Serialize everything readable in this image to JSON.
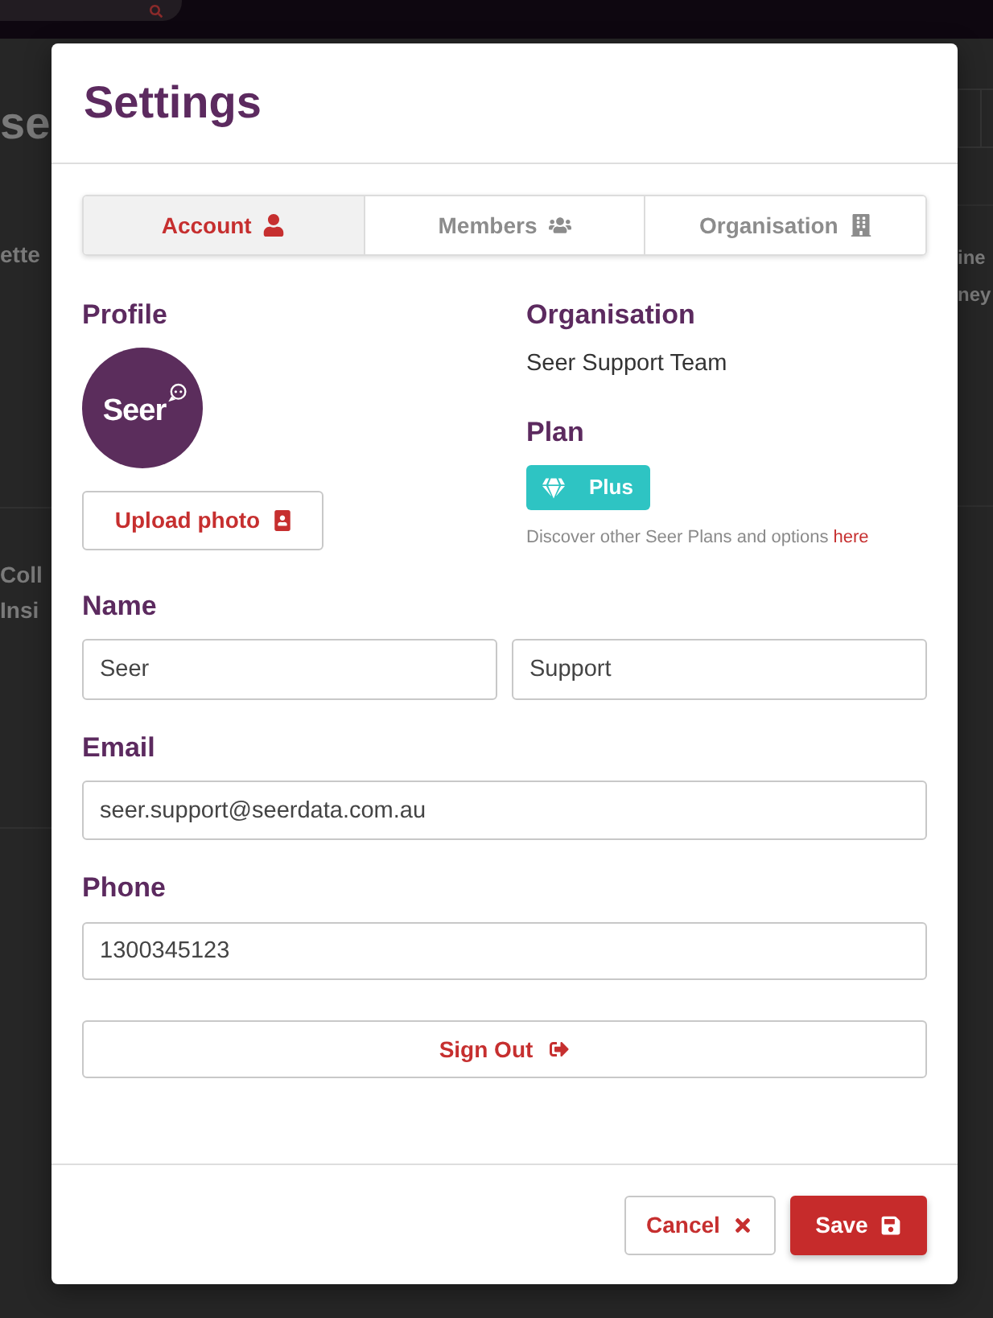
{
  "background": {
    "page_title": "se",
    "left_texts": [
      [
        "ette"
      ],
      [
        "Coll",
        "Insi"
      ]
    ],
    "right_texts": [
      "ine",
      "ney"
    ]
  },
  "dialog": {
    "title": "Settings",
    "tabs": [
      {
        "label": "Account",
        "selected": true
      },
      {
        "label": "Members",
        "selected": false
      },
      {
        "label": "Organisation",
        "selected": false
      }
    ],
    "profile": {
      "heading": "Profile",
      "logo_text": "Seer",
      "upload_button": "Upload photo"
    },
    "organisation": {
      "heading": "Organisation",
      "name": "Seer Support Team"
    },
    "plan": {
      "heading": "Plan",
      "badge": "Plus",
      "note": "Discover other Seer Plans and options",
      "note_link": "here"
    },
    "name": {
      "label": "Name",
      "fields": [
        {
          "value": "Seer"
        },
        {
          "value": "Support"
        }
      ]
    },
    "email": {
      "label": "Email",
      "value": "seer.support@seerdata.com.au"
    },
    "phone": {
      "label": "Phone",
      "value": "1300345123"
    },
    "sign_out_button": "Sign Out",
    "footer_buttons": [
      {
        "label": "Cancel",
        "kind": "secondary"
      },
      {
        "label": "Save",
        "kind": "primary"
      }
    ]
  }
}
